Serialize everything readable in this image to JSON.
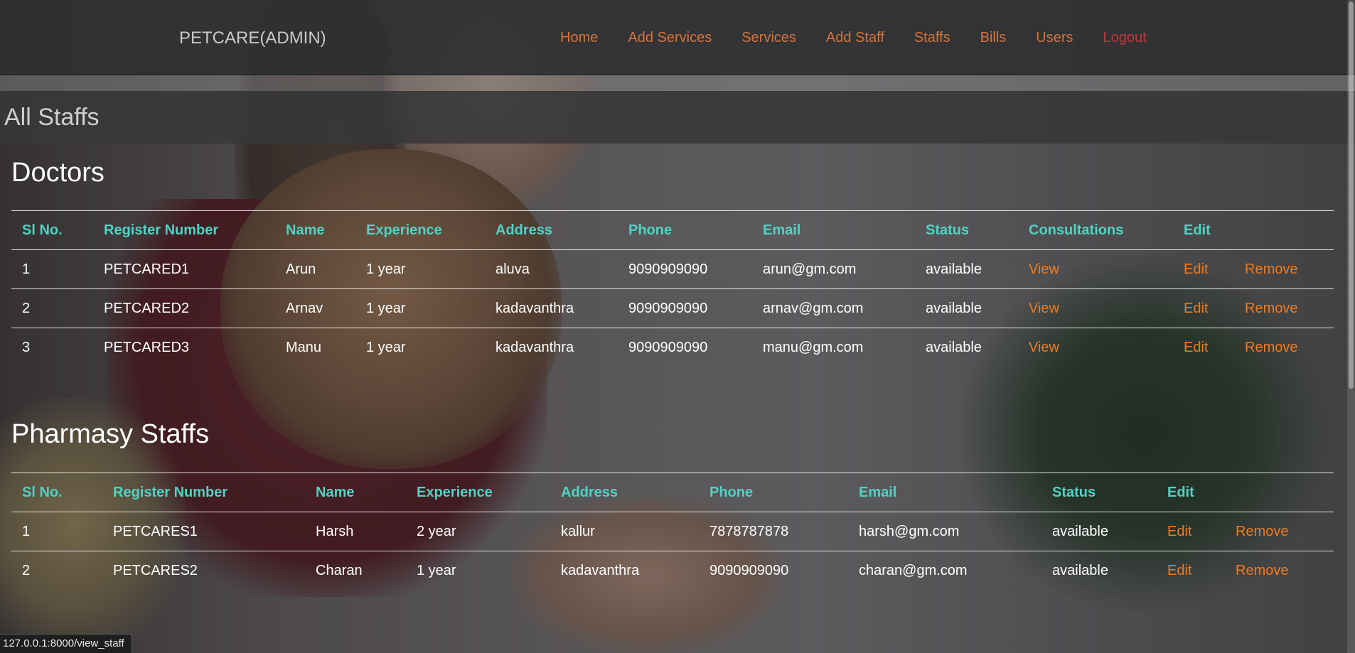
{
  "nav": {
    "brand": "PETCARE(ADMIN)",
    "links": [
      "Home",
      "Add Services",
      "Services",
      "Add Staff",
      "Staffs",
      "Bills",
      "Users",
      "Logout"
    ]
  },
  "page_title": "All Staffs",
  "doctors": {
    "heading": "Doctors",
    "columns": [
      "Sl No.",
      "Register Number",
      "Name",
      "Experience",
      "Address",
      "Phone",
      "Email",
      "Status",
      "Consultations",
      "Edit"
    ],
    "rows": [
      {
        "sl": "1",
        "reg": "PETCARED1",
        "name": "Arun",
        "exp": "1 year",
        "addr": "aluva",
        "phone": "9090909090",
        "email": "arun@gm.com",
        "status": "available",
        "consult": "View",
        "edit": "Edit",
        "remove": "Remove"
      },
      {
        "sl": "2",
        "reg": "PETCARED2",
        "name": "Arnav",
        "exp": "1 year",
        "addr": "kadavanthra",
        "phone": "9090909090",
        "email": "arnav@gm.com",
        "status": "available",
        "consult": "View",
        "edit": "Edit",
        "remove": "Remove"
      },
      {
        "sl": "3",
        "reg": "PETCARED3",
        "name": "Manu",
        "exp": "1 year",
        "addr": "kadavanthra",
        "phone": "9090909090",
        "email": "manu@gm.com",
        "status": "available",
        "consult": "View",
        "edit": "Edit",
        "remove": "Remove"
      }
    ]
  },
  "pharmacy": {
    "heading": "Pharmasy Staffs",
    "columns": [
      "Sl No.",
      "Register Number",
      "Name",
      "Experience",
      "Address",
      "Phone",
      "Email",
      "Status",
      "Edit"
    ],
    "rows": [
      {
        "sl": "1",
        "reg": "PETCARES1",
        "name": "Harsh",
        "exp": "2 year",
        "addr": "kallur",
        "phone": "7878787878",
        "email": "harsh@gm.com",
        "status": "available",
        "edit": "Edit",
        "remove": "Remove"
      },
      {
        "sl": "2",
        "reg": "PETCARES2",
        "name": "Charan",
        "exp": "1 year",
        "addr": "kadavanthra",
        "phone": "9090909090",
        "email": "charan@gm.com",
        "status": "available",
        "edit": "Edit",
        "remove": "Remove"
      }
    ]
  },
  "status_url": "127.0.0.1:8000/view_staff",
  "colors": {
    "link_orange": "#f07a1e",
    "header_teal": "#4fd3c4",
    "logout_red": "#c0383c"
  }
}
